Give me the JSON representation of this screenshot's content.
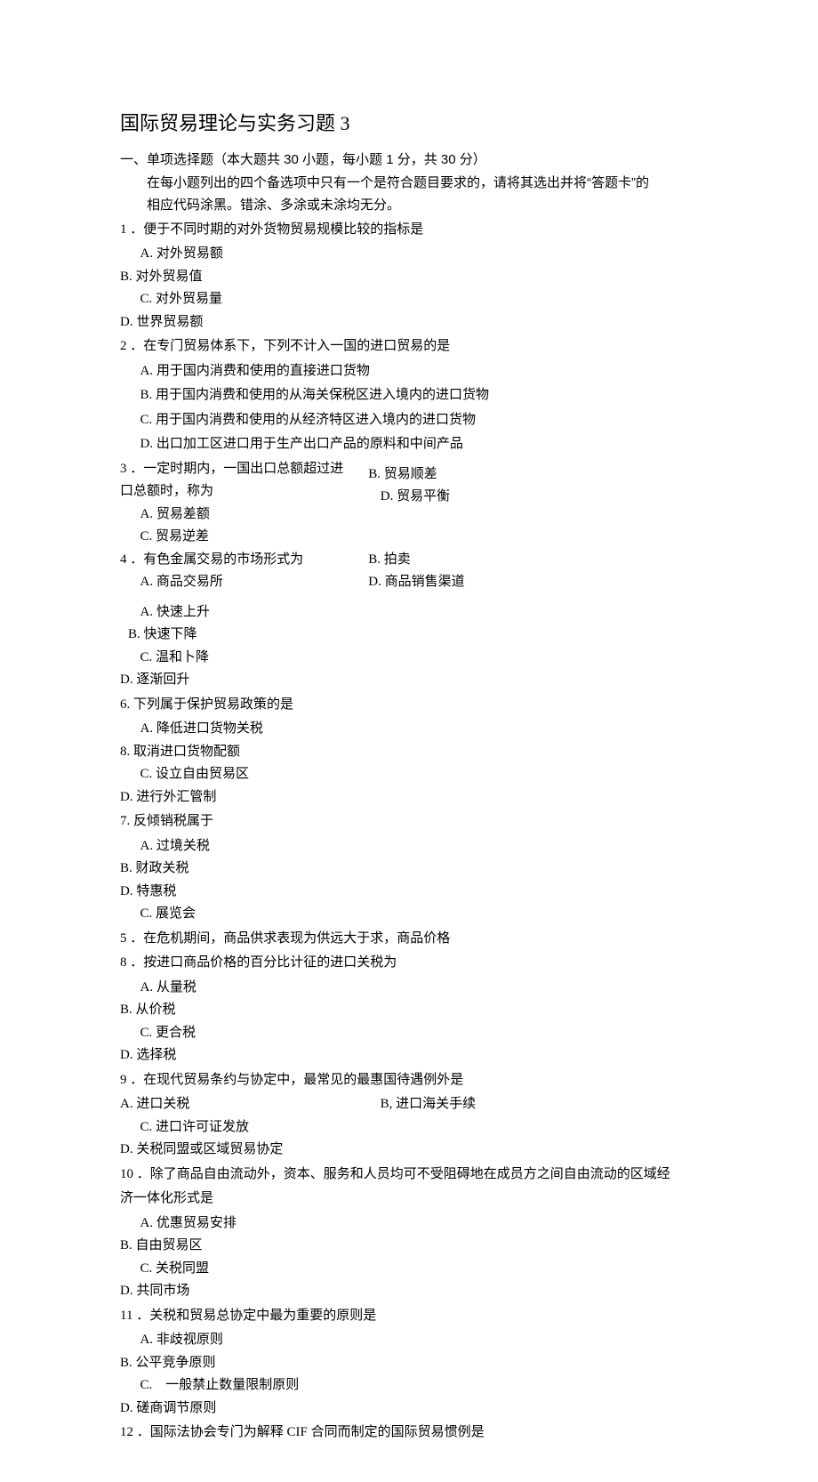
{
  "title": "国际贸易理论与实务习题 3",
  "section": {
    "head": "一、单项选择题（本大题共 30 小题，每小题 1 分，共 30 分）",
    "instr1": "在每小题列出的四个备选项中只有一个是符合题目要求的，请将其选出并将“答题卡”的",
    "instr2": "相应代码涂黑。错涂、多涂或未涂均无分。"
  },
  "q1": {
    "stem": "1 ．便于不同时期的对外货物贸易规模比较的指标是",
    "a": "A. 对外贸易额",
    "b": "B. 对外贸易值",
    "c": "C. 对外贸易量",
    "d": "D. 世界贸易额"
  },
  "q2": {
    "stem": "2 ．在专门贸易体系下，下列不计入一国的进口贸易的是",
    "a": "A. 用于国内消费和使用的直接进口货物",
    "b": "B. 用于国内消费和使用的从海关保税区进入境内的进口货物",
    "c": "C. 用于国内消费和使用的从经济特区进入境内的进口货物",
    "d": "D. 出口加工区进口用于生产出口产品的原料和中间产品"
  },
  "q3": {
    "stem1": "3 ．一定时期内，一国出口总额超过进",
    "stem2": "口总额时，称为",
    "a": "A. 贸易差额",
    "b": "B. 贸易顺差",
    "c": "C. 贸易逆差",
    "d": "D. 贸易平衡"
  },
  "q4": {
    "stem": "4 ．有色金属交易的市场形式为",
    "a": "A. 商品交易所",
    "b": "B. 拍卖",
    "d": "D. 商品销售渠道"
  },
  "q_ab_block": {
    "a": "A. 快速上升",
    "b": "B. 快速下降",
    "c": "C. 温和卜降",
    "d": "D. 逐渐回升"
  },
  "q6": {
    "stem": "6. 下列属于保护贸易政策的是",
    "a": "A. 降低进口货物关税",
    "b": "8. 取消进口货物配额",
    "c": "C. 设立自由贸易区",
    "d": "D. 进行外汇管制"
  },
  "q7": {
    "stem": "7. 反倾销税属于",
    "a": "A. 过境关税",
    "b": "B. 财政关税",
    "d": "D. 特惠税",
    "c": "C. 展览会"
  },
  "q5": {
    "stem": "5 ．在危机期间，商品供求表现为供远大于求，商品价格"
  },
  "q8": {
    "stem": "8 ．按进口商品价格的百分比计征的进口关税为",
    "a": "A. 从量税",
    "b": "B. 从价税",
    "c": "C. 更合税",
    "d": "D. 选择税"
  },
  "q9": {
    "stem": "9 ．在现代贸易条约与协定中，最常见的最惠国待遇例外是",
    "a": "A. 进口关税",
    "b": "B, 进口海关手续",
    "c": "C. 进口许可证发放",
    "d": "D. 关税同盟或区域贸易协定"
  },
  "q10": {
    "stem1": "10 ．除了商品自由流动外，资本、服务和人员均可不受阻碍地在成员方之间自由流动的区域经",
    "stem2": "济一体化形式是",
    "a": "A. 优惠贸易安排",
    "b": "B. 自由贸易区",
    "c": "C. 关税同盟",
    "d": "D. 共同市场"
  },
  "q11": {
    "stem": "11 ．关税和贸易总协定中最为重要的原则是",
    "a": "A. 非歧视原则",
    "b": "B. 公平竞争原则",
    "c": "C.　一般禁止数量限制原则",
    "d": "D. 磋商调节原则"
  },
  "q12": {
    "stem": "12 ．国际法协会专门为解释 CIF 合同而制定的国际贸易惯例是"
  }
}
